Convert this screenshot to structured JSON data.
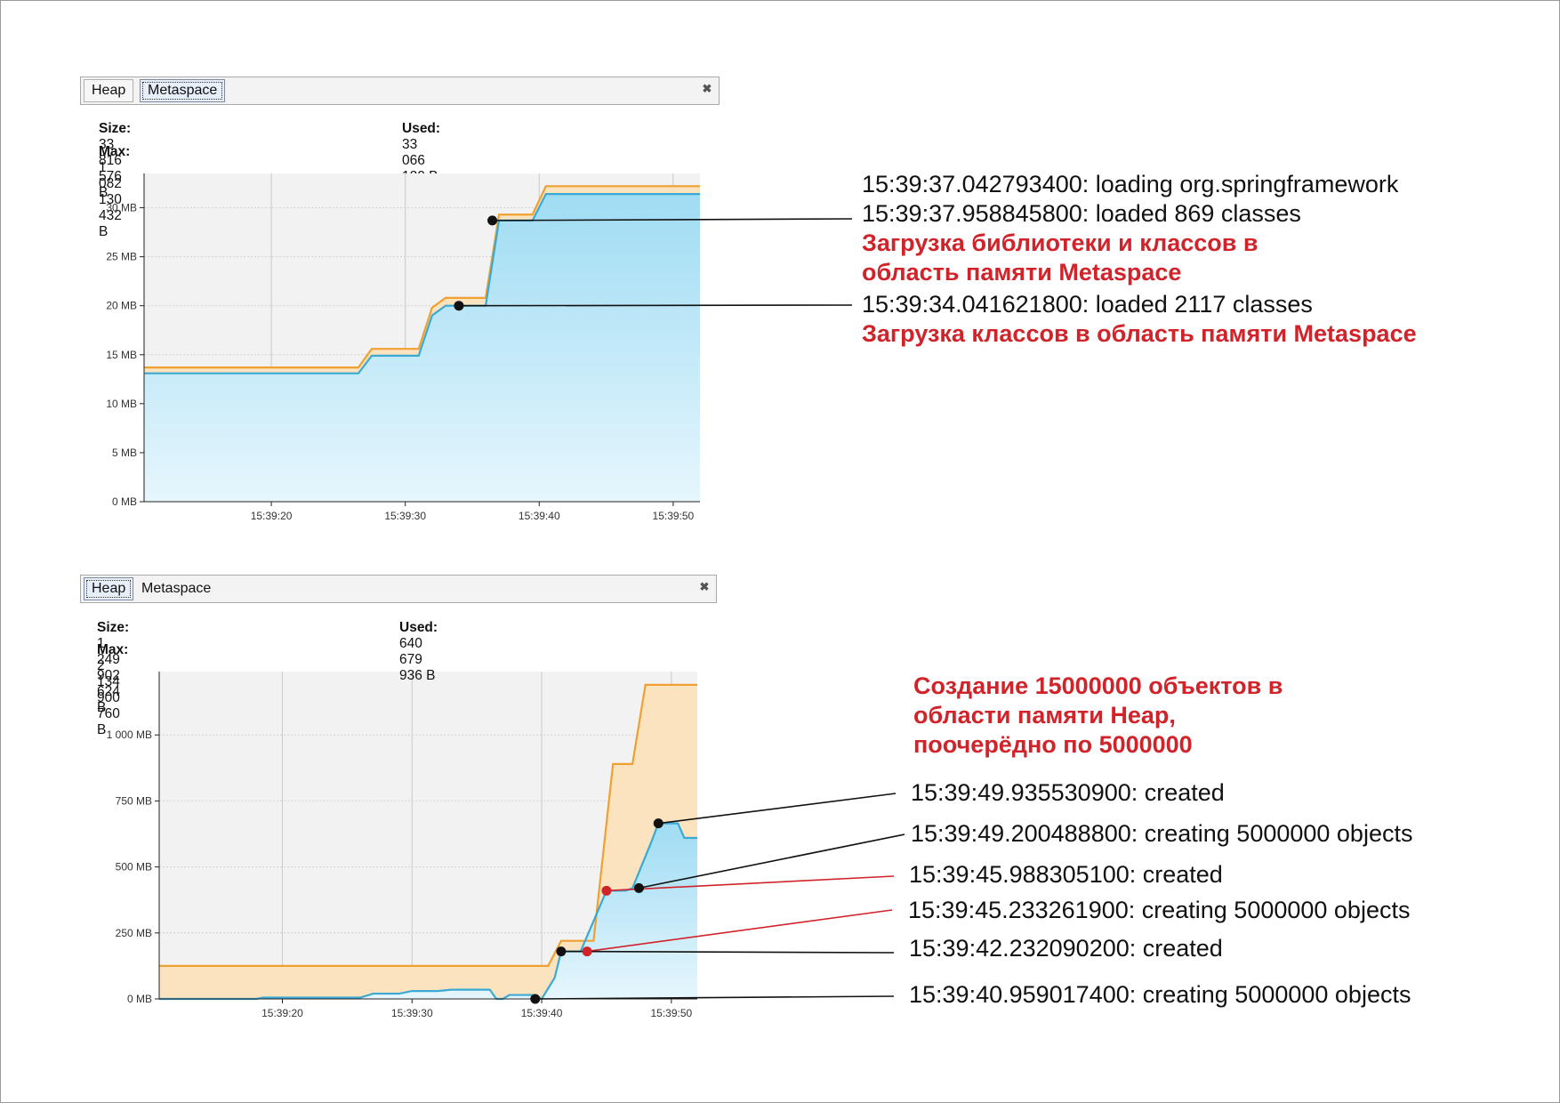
{
  "top_panel": {
    "tabs": [
      {
        "label": "Heap",
        "active": false
      },
      {
        "label": "Metaspace",
        "active": true
      }
    ],
    "size_label": "Size:",
    "size_value": "33 816 576 B",
    "used_label": "Used:",
    "used_value": "33 066 120 B",
    "max_label": "Max:",
    "max_value": "1 082 130 432 B",
    "close_icon": "close-icon"
  },
  "bottom_panel": {
    "tabs": [
      {
        "label": "Heap",
        "active": true
      },
      {
        "label": "Metaspace",
        "active": false
      }
    ],
    "size_label": "Size:",
    "size_value": "1 249 902 624 B",
    "used_label": "Used:",
    "used_value": "640 679 936 B",
    "max_label": "Max:",
    "max_value": "2 134 900 760 B",
    "close_icon": "close-icon"
  },
  "chart_data": [
    {
      "type": "area",
      "name": "metaspace",
      "ylim": [
        0,
        33.5
      ],
      "xlim_seconds": [
        11.5,
        53
      ],
      "y_ticks": [
        "0 MB",
        "5 MB",
        "10 MB",
        "15 MB",
        "20 MB",
        "25 MB",
        "30 MB"
      ],
      "y_tick_values": [
        0,
        5,
        10,
        15,
        20,
        25,
        30
      ],
      "x_ticks": [
        "15:39:20",
        "15:39:30",
        "15:39:40",
        "15:39:50"
      ],
      "x_tick_seconds": [
        21,
        31,
        41,
        51
      ],
      "colors": {
        "size": "#f0a030",
        "used": "#3aa9d4",
        "used_fill": "#bfe7f7",
        "size_fill": "#fbe3bf",
        "plot_bg": "#f2f2f2"
      },
      "size_series": {
        "x": [
          11.5,
          27.5,
          28.5,
          32.0,
          33.0,
          34.0,
          37.0,
          38.0,
          40.5,
          41.5,
          53
        ],
        "y": [
          13.7,
          13.7,
          15.6,
          15.6,
          19.8,
          20.8,
          20.8,
          29.3,
          29.3,
          32.2,
          32.2
        ]
      },
      "used_series": {
        "x": [
          11.5,
          27.5,
          28.5,
          32.0,
          33.0,
          34.0,
          37.0,
          38.0,
          40.5,
          41.5,
          53
        ],
        "y": [
          13.1,
          13.1,
          14.9,
          14.9,
          19.0,
          20.0,
          20.0,
          28.7,
          28.7,
          31.4,
          31.4
        ]
      },
      "markers": [
        {
          "x": 37.5,
          "y": 28.7,
          "color": "#111"
        },
        {
          "x": 35.0,
          "y": 20.0,
          "color": "#111"
        }
      ]
    },
    {
      "type": "area",
      "name": "heap",
      "ylim": [
        0,
        1240
      ],
      "xlim_seconds": [
        11.5,
        53
      ],
      "y_ticks": [
        "0 MB",
        "250 MB",
        "500 MB",
        "750 MB",
        "1 000 MB"
      ],
      "y_tick_values": [
        0,
        250,
        500,
        750,
        1000
      ],
      "x_ticks": [
        "15:39:20",
        "15:39:30",
        "15:39:40",
        "15:39:50"
      ],
      "x_tick_seconds": [
        21,
        31,
        41,
        51
      ],
      "colors": {
        "size": "#f0a030",
        "used": "#3aa9d4",
        "used_fill": "#bfe7f7",
        "size_fill": "#fbe3bf",
        "plot_bg": "#f2f2f2"
      },
      "size_series": {
        "x": [
          11.5,
          41.5,
          42.5,
          45.0,
          46.5,
          48.0,
          49.0,
          50.0,
          53
        ],
        "y": [
          125,
          125,
          220,
          220,
          890,
          890,
          1190,
          1190,
          1190
        ]
      },
      "used_series": {
        "x": [
          11.5,
          19.0,
          19.5,
          27.0,
          28.0,
          30.0,
          31.0,
          33.0,
          34.0,
          37.0,
          37.5,
          38.0,
          38.5,
          40.5,
          41.0,
          42.0,
          42.5,
          44.0,
          46.0,
          47.5,
          48.0,
          49.5,
          50.0,
          51.5,
          52.0,
          53
        ],
        "y": [
          0,
          0,
          5,
          5,
          20,
          20,
          30,
          30,
          35,
          35,
          0,
          0,
          15,
          15,
          0,
          80,
          180,
          180,
          410,
          410,
          420,
          600,
          665,
          665,
          610,
          610
        ]
      },
      "markers": [
        {
          "x": 50.0,
          "y": 665,
          "color": "#111"
        },
        {
          "x": 48.5,
          "y": 420,
          "color": "#111"
        },
        {
          "x": 46.0,
          "y": 410,
          "color": "#d1232a"
        },
        {
          "x": 44.5,
          "y": 180,
          "color": "#d1232a"
        },
        {
          "x": 42.5,
          "y": 180,
          "color": "#111"
        },
        {
          "x": 40.5,
          "y": 0,
          "color": "#111"
        }
      ]
    }
  ],
  "annotations_top": {
    "line1": "15:39:37.042793400: loading org.springframework",
    "line2": "15:39:37.958845800: loaded 869 classes",
    "red1a": "Загрузка библиотеки и классов в",
    "red1b": "область памяти  Metaspace",
    "line3": "15:39:34.041621800: loaded 2117 classes",
    "red2": "Загрузка классов в область памяти  Metaspace"
  },
  "annotations_bottom": {
    "red_title_1": "Создание 15000000 объектов в",
    "red_title_2": "области памяти Heap,",
    "red_title_3": "поочерёдно по 5000000",
    "e1": "15:39:49.935530900: created",
    "e2": "15:39:49.200488800: creating 5000000 objects",
    "e3": "15:39:45.988305100: created",
    "e4": "15:39:45.233261900: creating 5000000 objects",
    "e5": "15:39:42.232090200: created",
    "e6": "15:39:40.959017400: creating 5000000 objects"
  }
}
